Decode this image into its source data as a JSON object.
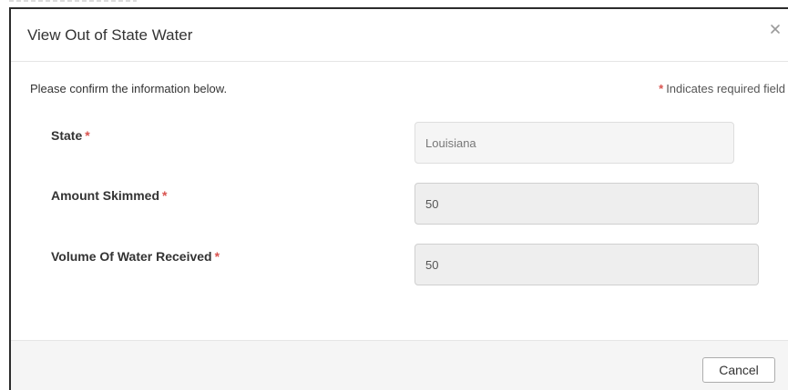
{
  "dialog": {
    "title": "View Out of State Water",
    "intro": "Please confirm the information below.",
    "required_note": "Indicates required field",
    "required_marker": "*"
  },
  "fields": {
    "state": {
      "label": "State",
      "value": "Louisiana"
    },
    "amount_skimmed": {
      "label": "Amount Skimmed",
      "value": "50"
    },
    "volume_received": {
      "label": "Volume Of Water Received",
      "value": "50"
    }
  },
  "footer": {
    "cancel_label": "Cancel"
  },
  "colors": {
    "required": "#d9534f",
    "field_bg": "#eeeeee",
    "footer_bg": "#f5f5f5"
  },
  "icons": {
    "close": "close-icon"
  }
}
